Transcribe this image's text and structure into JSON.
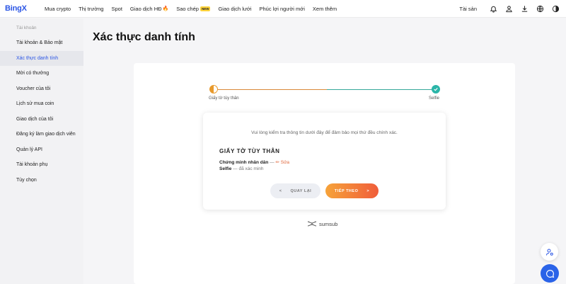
{
  "brand": {
    "logo": "BingX",
    "accent": "#2a55e5"
  },
  "nav": {
    "items": [
      {
        "label": "Mua crypto"
      },
      {
        "label": "Thị trường"
      },
      {
        "label": "Spot"
      },
      {
        "label": "Giao dịch HĐ"
      },
      {
        "label": "Sao chép",
        "badge": "NEW"
      },
      {
        "label": "Giao dịch lưới"
      },
      {
        "label": "Phúc lợi người mới"
      },
      {
        "label": "Xem thêm"
      }
    ],
    "assets_label": "Tài sản"
  },
  "sidebar": {
    "heading": "Tài khoản",
    "items": [
      {
        "label": "Tài khoản & Bảo mật"
      },
      {
        "label": "Xác thực danh tính",
        "active": true
      },
      {
        "label": "Mời có thưởng"
      },
      {
        "label": "Voucher của tôi"
      },
      {
        "label": "Lịch sử mua coin"
      },
      {
        "label": "Giao dịch của tôi"
      },
      {
        "label": "Đăng ký làm giao dịch viên"
      },
      {
        "label": "Quản lý API"
      },
      {
        "label": "Tài khoản phụ"
      },
      {
        "label": "Tùy chọn"
      }
    ]
  },
  "main": {
    "title": "Xác thực danh tính",
    "stepper": {
      "step1": "Giấy tờ tùy thân",
      "step2": "Selfie"
    },
    "review": {
      "note": "Vui lòng kiểm tra thông tin dưới đây để đảm bảo mọi thứ đều chính xác.",
      "heading": "GIẤY TỜ TÙY THÂN",
      "doc_label": "Chứng minh nhân dân",
      "dash": "—",
      "edit_label": "Sửa",
      "selfie_label": "Selfie",
      "selfie_status": "— đã xác minh",
      "back_label": "QUAY LẠI",
      "next_label": "TIẾP THEO",
      "back_arrow": "<",
      "next_arrow": ">"
    },
    "provider": "sumsub"
  },
  "colors": {
    "step_orange": "#e89a2c",
    "step_teal": "#2bb5a8",
    "button_gradient_start": "#f6a33a",
    "button_gradient_end": "#f05d3a",
    "chat_blue": "#2a63e8"
  }
}
